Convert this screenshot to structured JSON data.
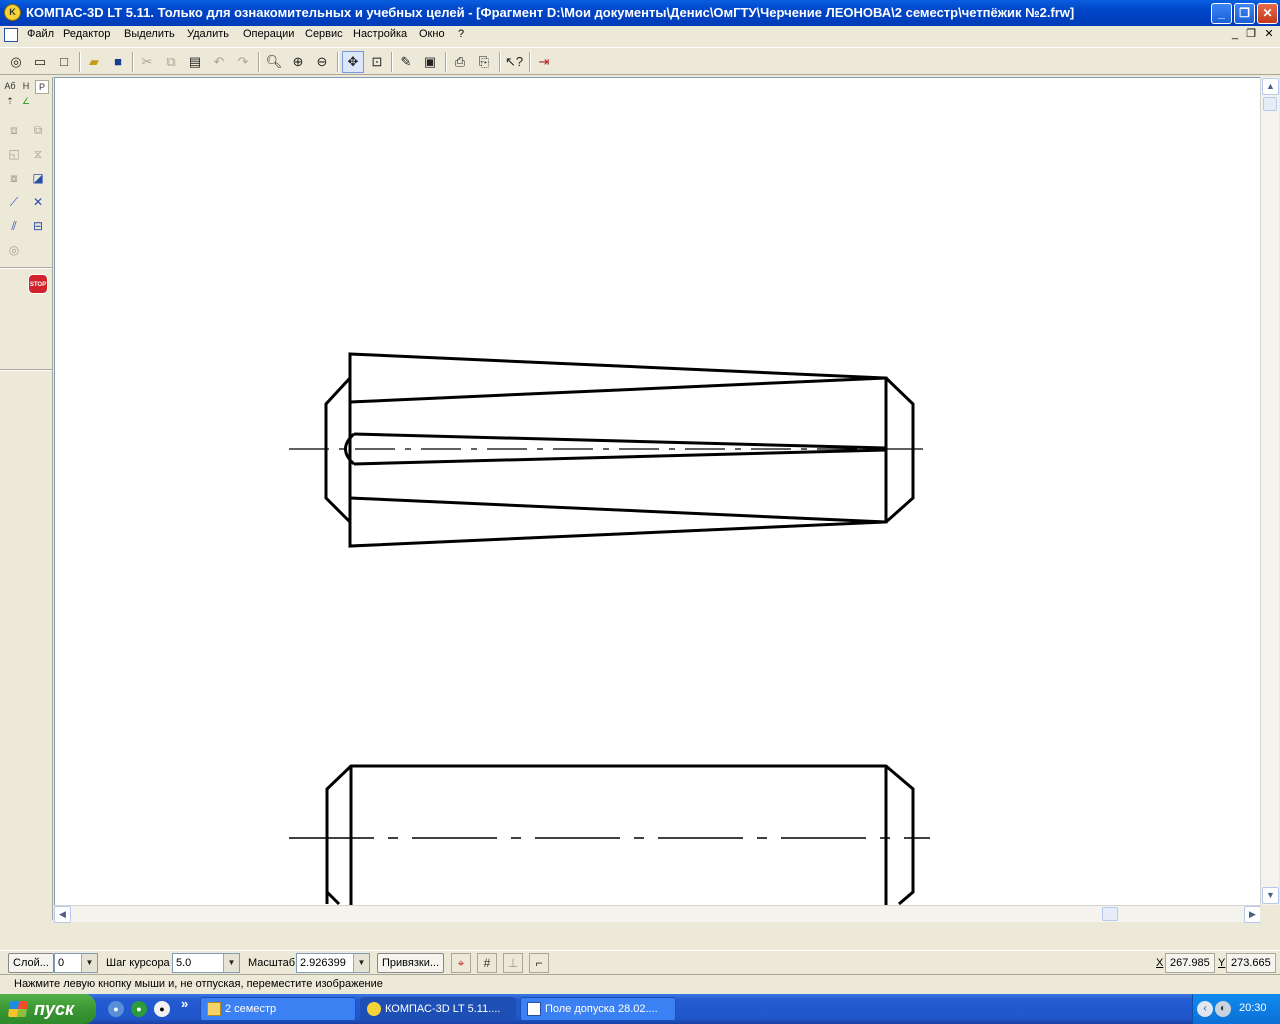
{
  "window": {
    "title": "КОМПАС-3D LT 5.11. Только для ознакомительных и учебных целей - [Фрагмент D:\\Мои документы\\Денис\\ОмГТУ\\Черчение ЛЕОНОВА\\2 семестр\\четпёжик №2.frw]",
    "controls": {
      "minimize": "_",
      "restore": "❐",
      "close": "✕"
    }
  },
  "menu": {
    "items": [
      "Файл",
      "Редактор",
      "Выделить",
      "Удалить",
      "Операции",
      "Сервис",
      "Настройка",
      "Окно",
      "?"
    ],
    "mdi_controls": {
      "minimize": "_",
      "restore": "❐",
      "close": "✕"
    }
  },
  "left_panel": {
    "tabs": [
      "Аб",
      "Н",
      "Р"
    ],
    "stop_label": "STOP"
  },
  "statusbar": {
    "layer_button": "Слой...",
    "layer_value": "0",
    "step_label": "Шаг курсора",
    "step_value": "5.0",
    "scale_label": "Масштаб",
    "scale_value": "2.926399",
    "snaps_button": "Привязки...",
    "x_label": "X",
    "x_value": "267.985",
    "y_label": "Y",
    "y_value": "273.665"
  },
  "hint": "Нажмите левую кнопку мыши и, не отпуская, переместите изображение",
  "taskbar": {
    "start_label": "пуск",
    "more": "»",
    "tasks": [
      {
        "label": "2 семестр"
      },
      {
        "label": "КОМПАС-3D LT 5.11...."
      },
      {
        "label": "Поле допуска 28.02...."
      }
    ],
    "clock": "20:30"
  }
}
